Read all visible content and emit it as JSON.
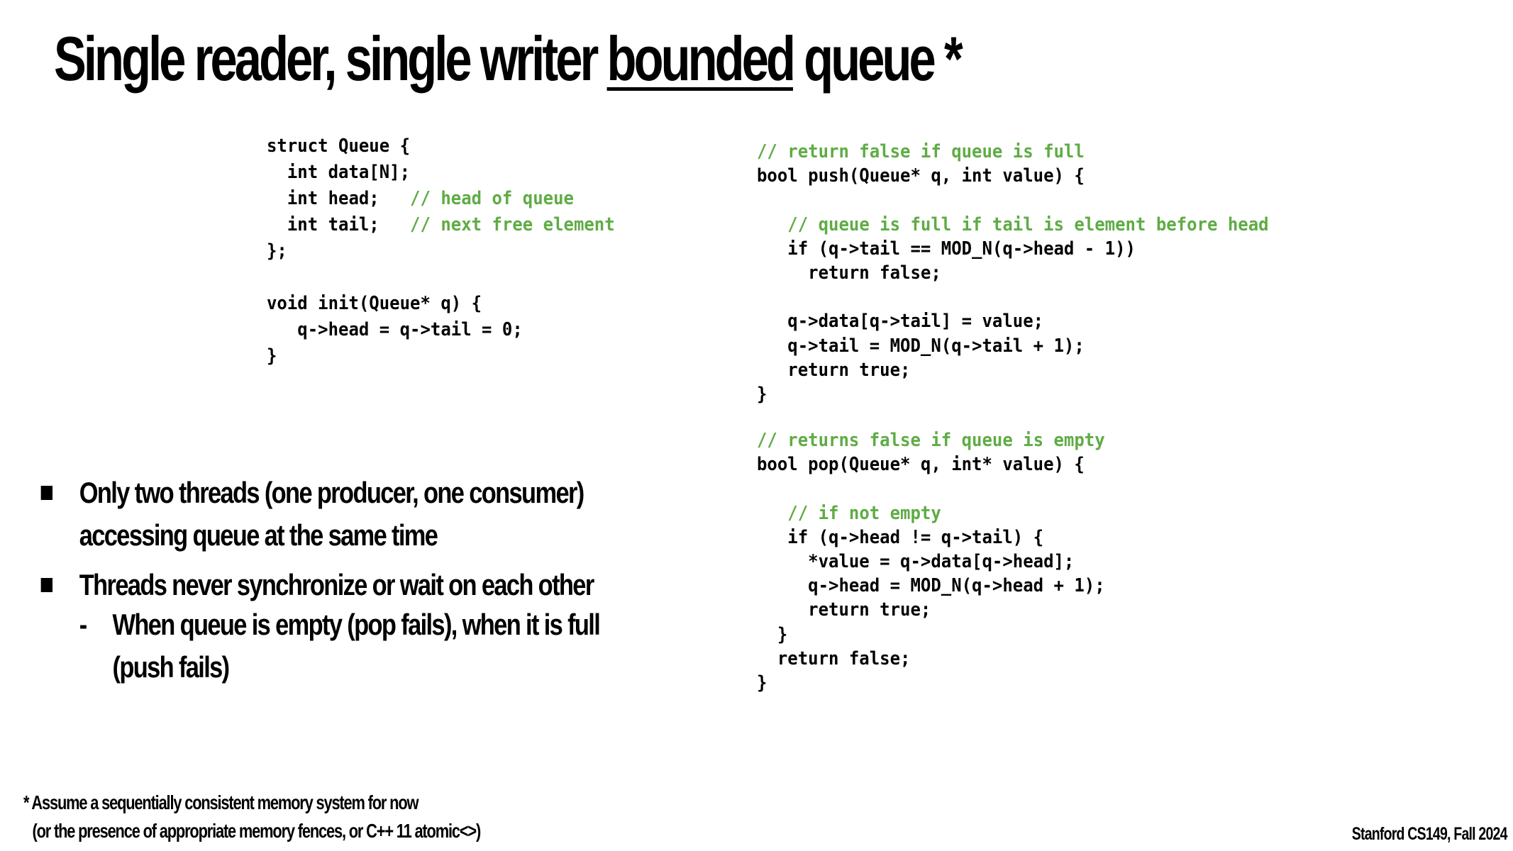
{
  "slide": {
    "title_prefix": "Single reader, single writer ",
    "title_underlined": "bounded",
    "title_suffix": " queue *"
  },
  "code_struct": {
    "lines": [
      {
        "code": "struct Queue {",
        "comment": ""
      },
      {
        "code": "  int data[N];",
        "comment": ""
      },
      {
        "code": "  int head;   ",
        "comment": "// head of queue"
      },
      {
        "code": "  int tail;   ",
        "comment": "// next free element"
      },
      {
        "code": "};",
        "comment": ""
      },
      {
        "code": "",
        "comment": ""
      },
      {
        "code": "void init(Queue* q) {",
        "comment": ""
      },
      {
        "code": "   q->head = q->tail = 0;",
        "comment": ""
      },
      {
        "code": "}",
        "comment": ""
      }
    ]
  },
  "code_push": {
    "lines": [
      {
        "code": "",
        "comment": "// return false if queue is full"
      },
      {
        "code": "bool push(Queue* q, int value) {",
        "comment": ""
      },
      {
        "code": "",
        "comment": ""
      },
      {
        "code": "   ",
        "comment": "// queue is full if tail is element before head"
      },
      {
        "code": "   if (q->tail == MOD_N(q->head - 1))",
        "comment": ""
      },
      {
        "code": "     return false;",
        "comment": ""
      },
      {
        "code": "",
        "comment": ""
      },
      {
        "code": "   q->data[q->tail] = value;",
        "comment": ""
      },
      {
        "code": "   q->tail = MOD_N(q->tail + 1);",
        "comment": ""
      },
      {
        "code": "   return true;",
        "comment": ""
      },
      {
        "code": "}",
        "comment": ""
      }
    ]
  },
  "code_pop": {
    "lines": [
      {
        "code": "",
        "comment": "// returns false if queue is empty"
      },
      {
        "code": "bool pop(Queue* q, int* value) {",
        "comment": ""
      },
      {
        "code": "",
        "comment": ""
      },
      {
        "code": "   ",
        "comment": "// if not empty"
      },
      {
        "code": "   if (q->head != q->tail) {",
        "comment": ""
      },
      {
        "code": "     *value = q->data[q->head];",
        "comment": ""
      },
      {
        "code": "     q->head = MOD_N(q->head + 1);",
        "comment": ""
      },
      {
        "code": "     return true;",
        "comment": ""
      },
      {
        "code": "  }",
        "comment": ""
      },
      {
        "code": "  return false;",
        "comment": ""
      },
      {
        "code": "}",
        "comment": ""
      }
    ]
  },
  "bullets": [
    {
      "text": "Only two threads (one producer, one consumer) accessing queue at the same time",
      "line1": "Only two threads (one producer, one consumer)",
      "line2": "accessing queue at the same time"
    },
    {
      "text": "Threads never synchronize or wait on each other",
      "line1": "Threads never synchronize or wait on each other",
      "sub": {
        "dash": "-",
        "line1": "When queue is empty (pop fails), when it is full",
        "line2": "(push fails)"
      }
    }
  ],
  "footnote": {
    "line1": "* Assume a sequentially consistent memory system for now",
    "line2": "(or the presence of appropriate memory fences, or C++ 11 atomic<>)"
  },
  "course_label": "Stanford CS149, Fall 2024"
}
